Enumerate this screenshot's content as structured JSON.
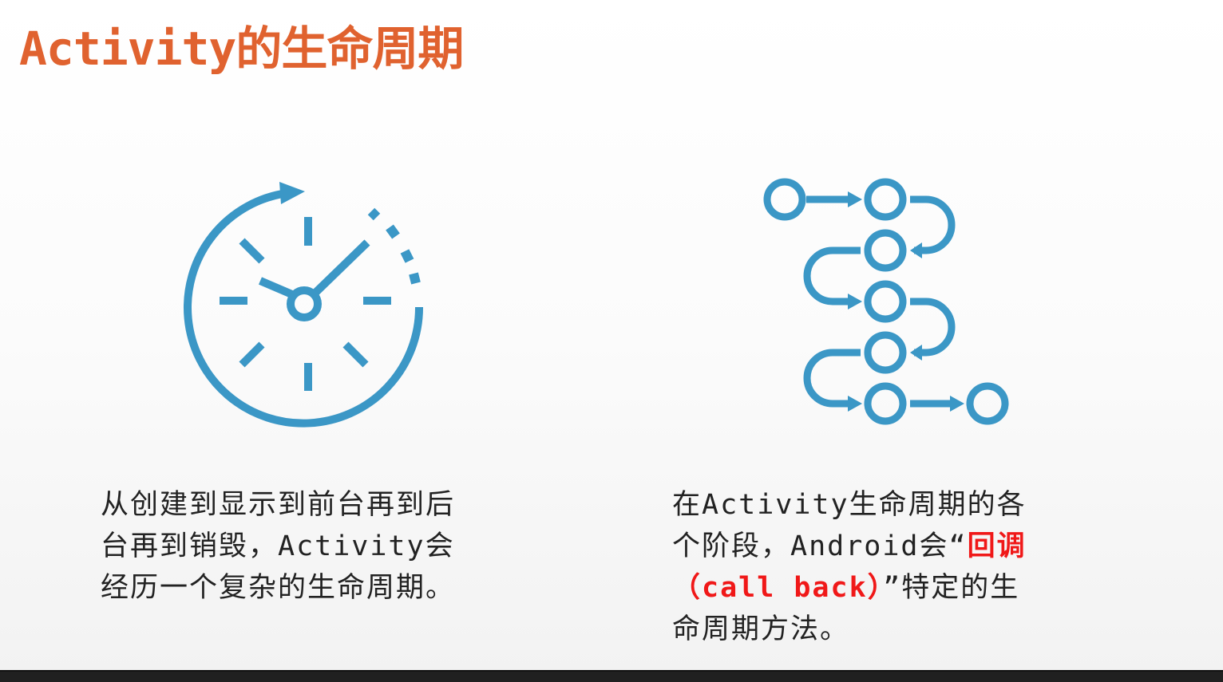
{
  "title": "Activity的生命周期",
  "left_text": [
    "从创建到显示到前台再到后",
    "台再到销毁，Activity会",
    "经历一个复杂的生命周期。"
  ],
  "right_text": {
    "line1": "在Activity生命周期的各",
    "line2_pre": "个阶段，Android会“",
    "line2_red": "回调",
    "line3_red": "（call back）",
    "line3_post": "”特定的生",
    "line4": "命周期方法。"
  },
  "colors": {
    "title": "#e0622f",
    "icon": "#3b97c6",
    "highlight": "#f01818"
  }
}
